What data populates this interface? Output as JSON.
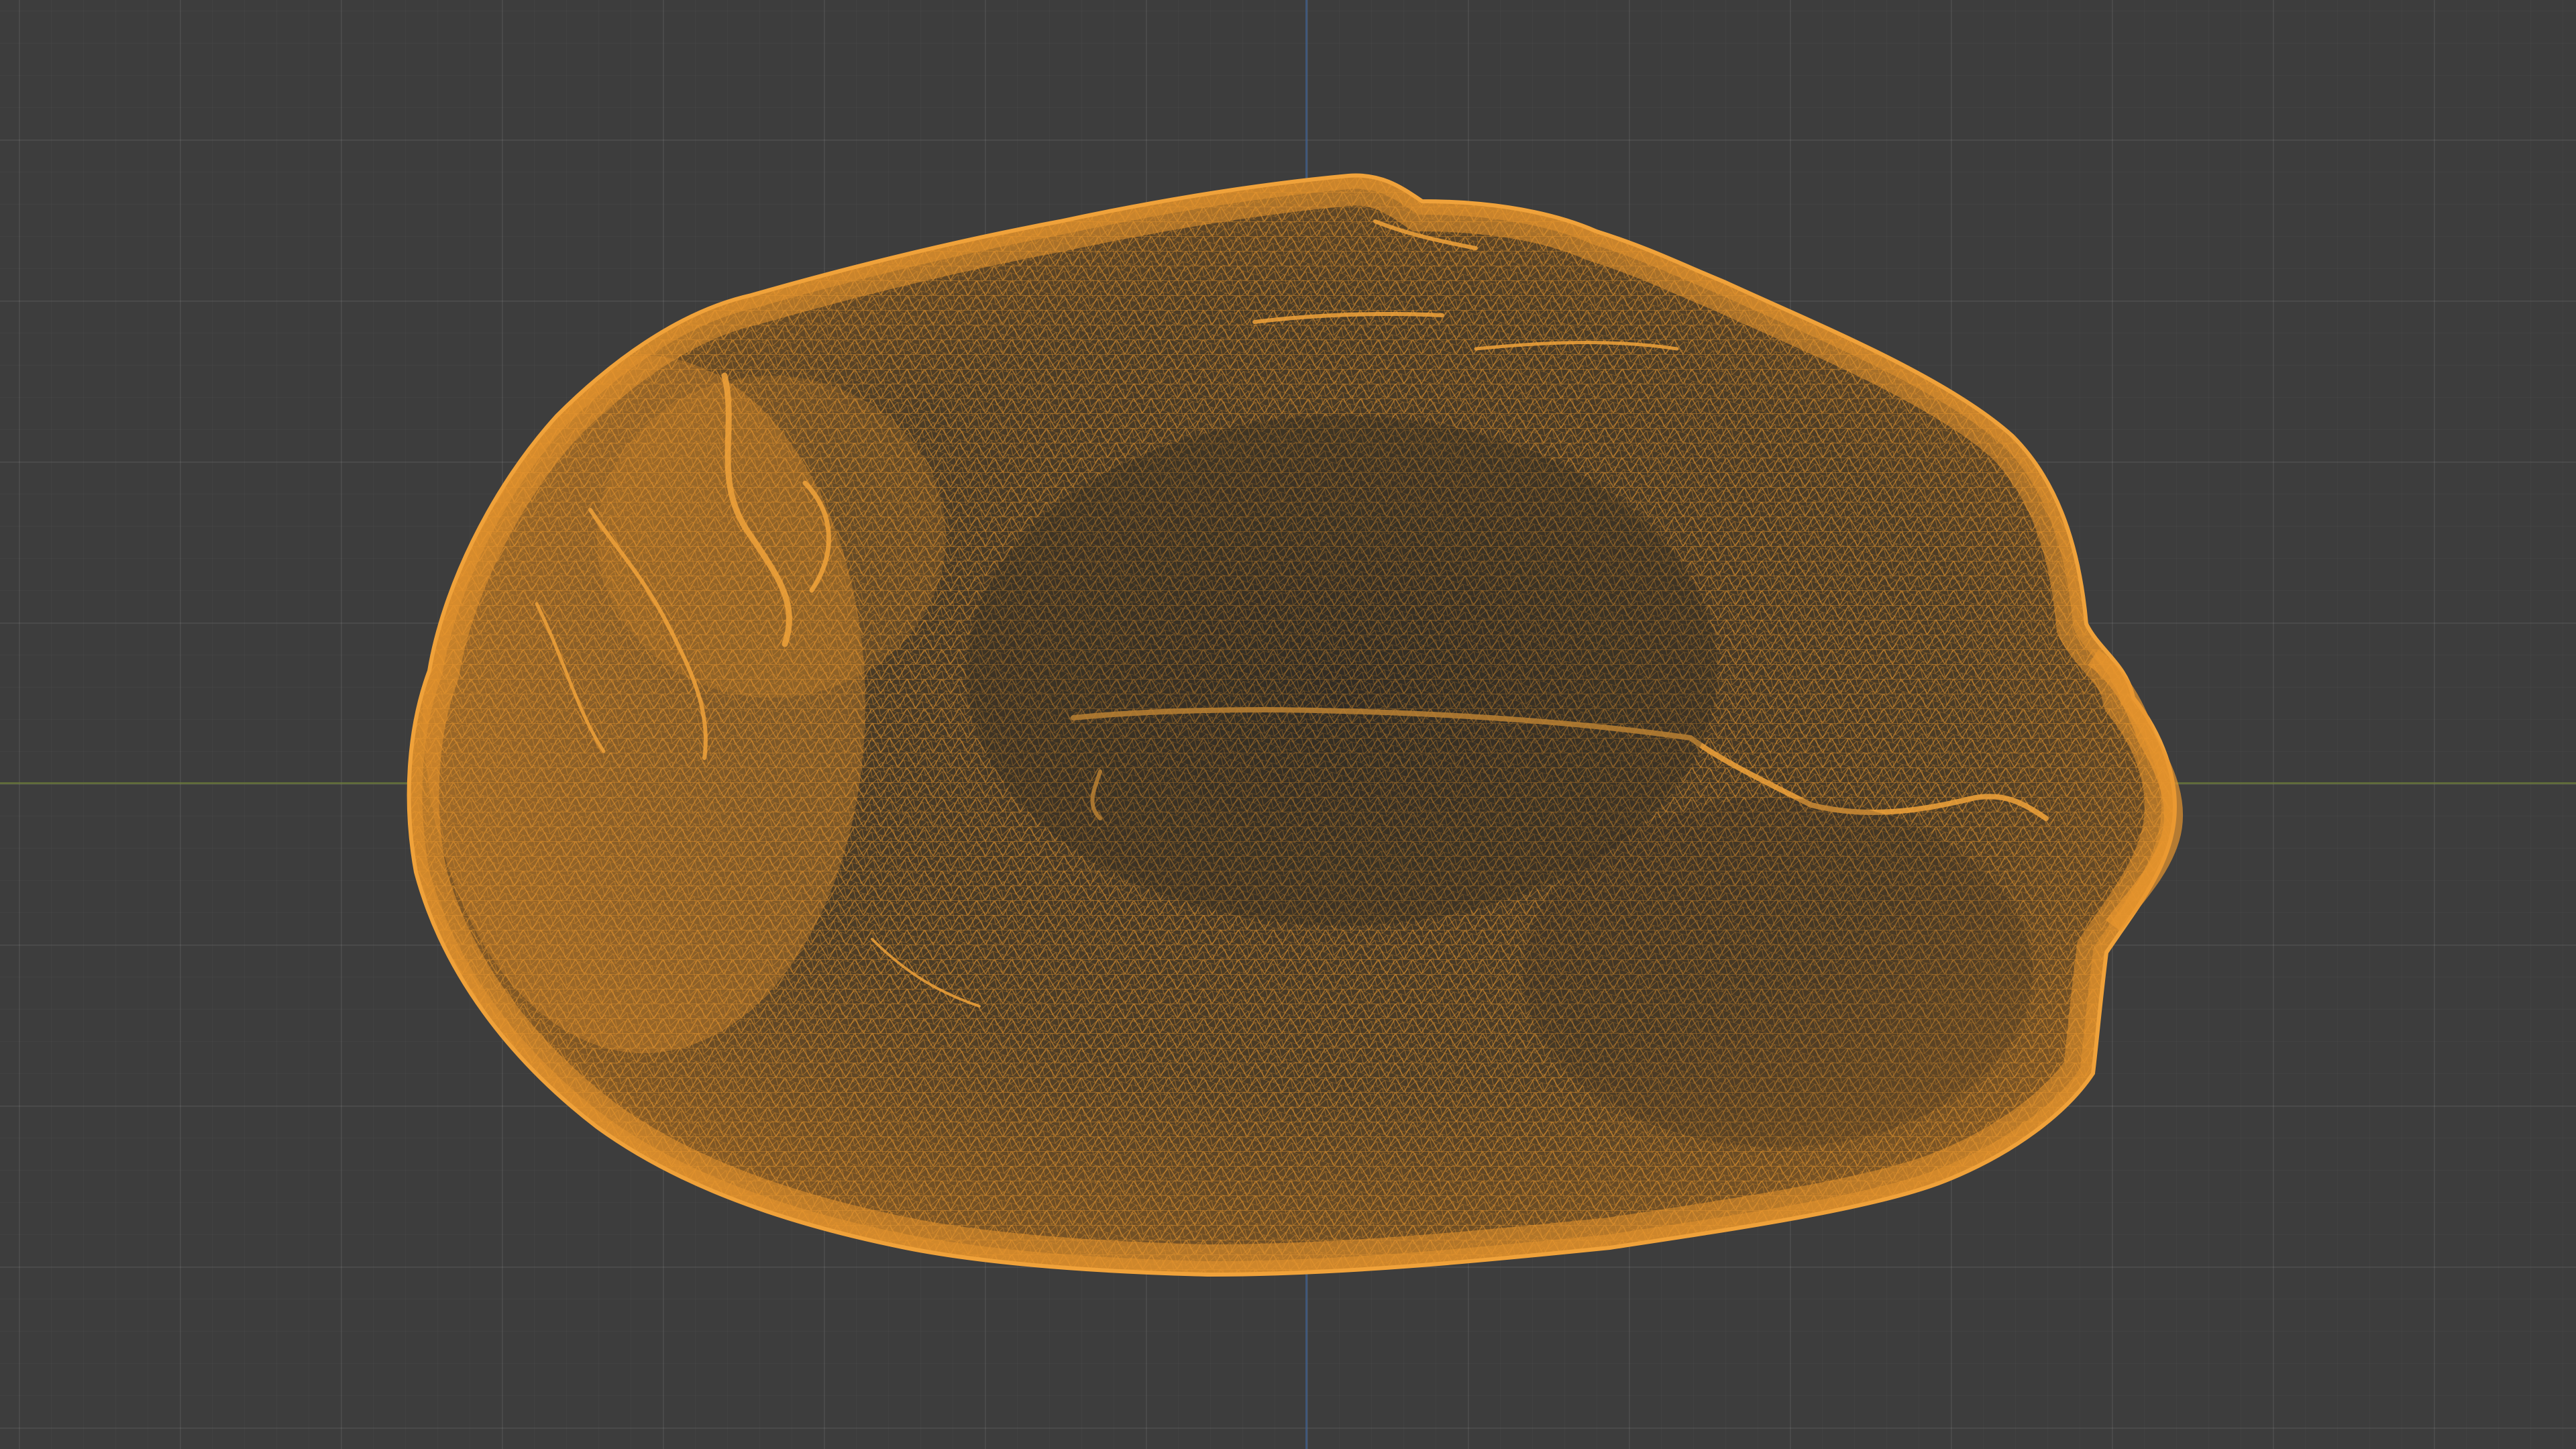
{
  "viewport": {
    "background_color": "#3d3d3d",
    "grid_color": "#4a4a4a",
    "x_axis_color": "#6b7a3a",
    "y_axis_color": "#3f5f8c",
    "shading_mode": "wireframe"
  },
  "object": {
    "icon": "mesh-wireframe-icon",
    "selected": true,
    "wire_color": "#e8962e",
    "shape": "irregular ovoid rock"
  }
}
